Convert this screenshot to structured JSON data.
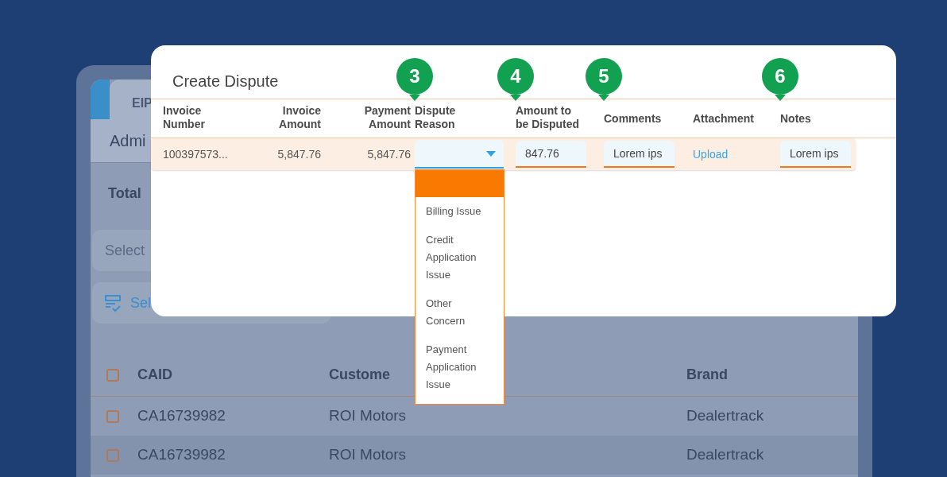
{
  "background_app": {
    "tab": {
      "label": "EIP",
      "selected": true
    },
    "header_text": "Admi",
    "total_label": "Total",
    "select_field": {
      "placeholder": "Select"
    },
    "action_button": {
      "label": "Sel"
    },
    "table": {
      "header_checkbox": {
        "checked": false
      },
      "columns": [
        "CAID",
        "Custome",
        "Brand"
      ],
      "rows": [
        {
          "checked": false,
          "cells": [
            "CA16739982",
            "ROI Motors",
            "Dealertrack"
          ]
        },
        {
          "checked": false,
          "cells": [
            "CA16739982",
            "ROI Motors",
            "Dealertrack"
          ]
        }
      ]
    }
  },
  "dialog": {
    "title": "Create Dispute",
    "columns": [
      {
        "label": "Invoice Number"
      },
      {
        "label": "Invoice Amount"
      },
      {
        "label": "Payment Amount"
      },
      {
        "label": "Dispute Reason",
        "badge": "3"
      },
      {
        "label": "Amount to be Disputed",
        "badge": "4"
      },
      {
        "label": "Comments",
        "badge": "5"
      },
      {
        "label": "Attachment"
      },
      {
        "label": "Notes",
        "badge": "6"
      }
    ],
    "row": [
      {
        "kind": "text",
        "value": "100397573..."
      },
      {
        "kind": "number",
        "value": "5,847.76"
      },
      {
        "kind": "number",
        "value": "5,847.76"
      },
      {
        "kind": "select"
      },
      {
        "kind": "input",
        "value": "847.76"
      },
      {
        "kind": "input",
        "value": "Lorem ips"
      },
      {
        "kind": "link",
        "value": "Upload"
      },
      {
        "kind": "input",
        "value": "Lorem ips"
      }
    ],
    "dropdown": {
      "blank_option_highlighted": true,
      "options": [
        {
          "label": "Billing Issue",
          "selected": false
        },
        {
          "label": "Credit Application Issue",
          "selected": false
        },
        {
          "label": "Other Concern",
          "selected": false
        },
        {
          "label": "Payment Application Issue",
          "selected": false
        }
      ]
    }
  }
}
